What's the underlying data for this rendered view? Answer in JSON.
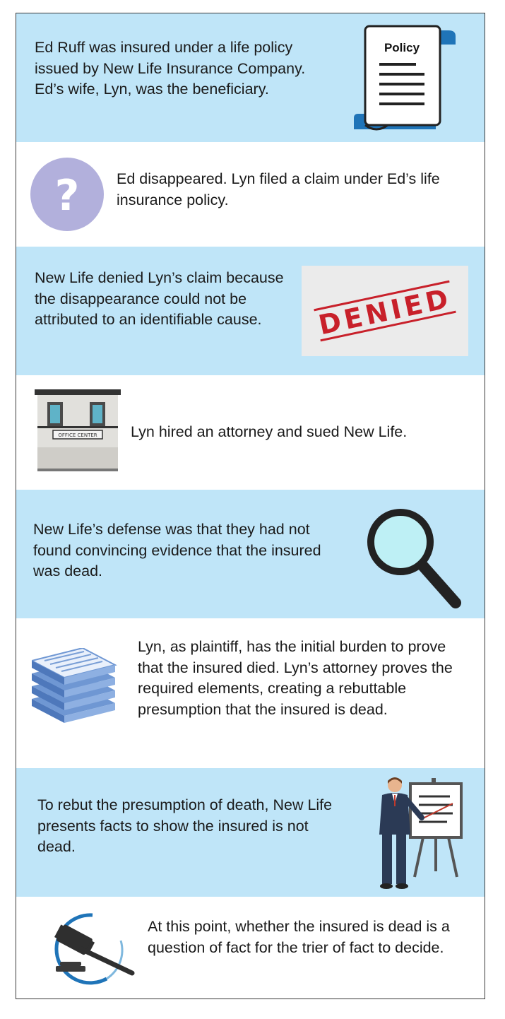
{
  "steps": [
    {
      "text": "Ed Ruff was insured under a life policy issued by New Life Insurance Company. Ed’s wife, Lyn, was the beneficiary.",
      "icon": "policy-scroll-icon",
      "icon_label": "Policy"
    },
    {
      "text": "Ed disappeared. Lyn filed a claim under Ed’s life insurance policy.",
      "icon": "question-mark-icon"
    },
    {
      "text": "New Life denied Lyn’s claim because the disappearance could not be attributed to an identifiable cause.",
      "icon": "denied-stamp-icon",
      "icon_label": "DENIED"
    },
    {
      "text": "Lyn hired an attorney and sued New Life.",
      "icon": "office-building-icon",
      "icon_label": "OFFICE CENTER"
    },
    {
      "text": "New Life’s defense was that they had not found convincing evidence that the insured was dead.",
      "icon": "magnifying-glass-icon"
    },
    {
      "text": "Lyn, as plaintiff, has the initial burden to prove that the insured died. Lyn’s attorney proves the required elements, creating a rebuttable presumption that the insured is dead.",
      "icon": "document-stack-icon"
    },
    {
      "text": "To rebut the presumption of death, New Life presents facts to show the insured is not dead.",
      "icon": "presenter-icon"
    },
    {
      "text": "At this point, whether the insured is dead is a question of fact for the trier of fact to decide.",
      "icon": "gavel-icon"
    }
  ],
  "colors": {
    "panel_blue": "#bfe5f8",
    "panel_white": "#ffffff",
    "text": "#1a1a1a",
    "border": "#3a3a3a"
  }
}
